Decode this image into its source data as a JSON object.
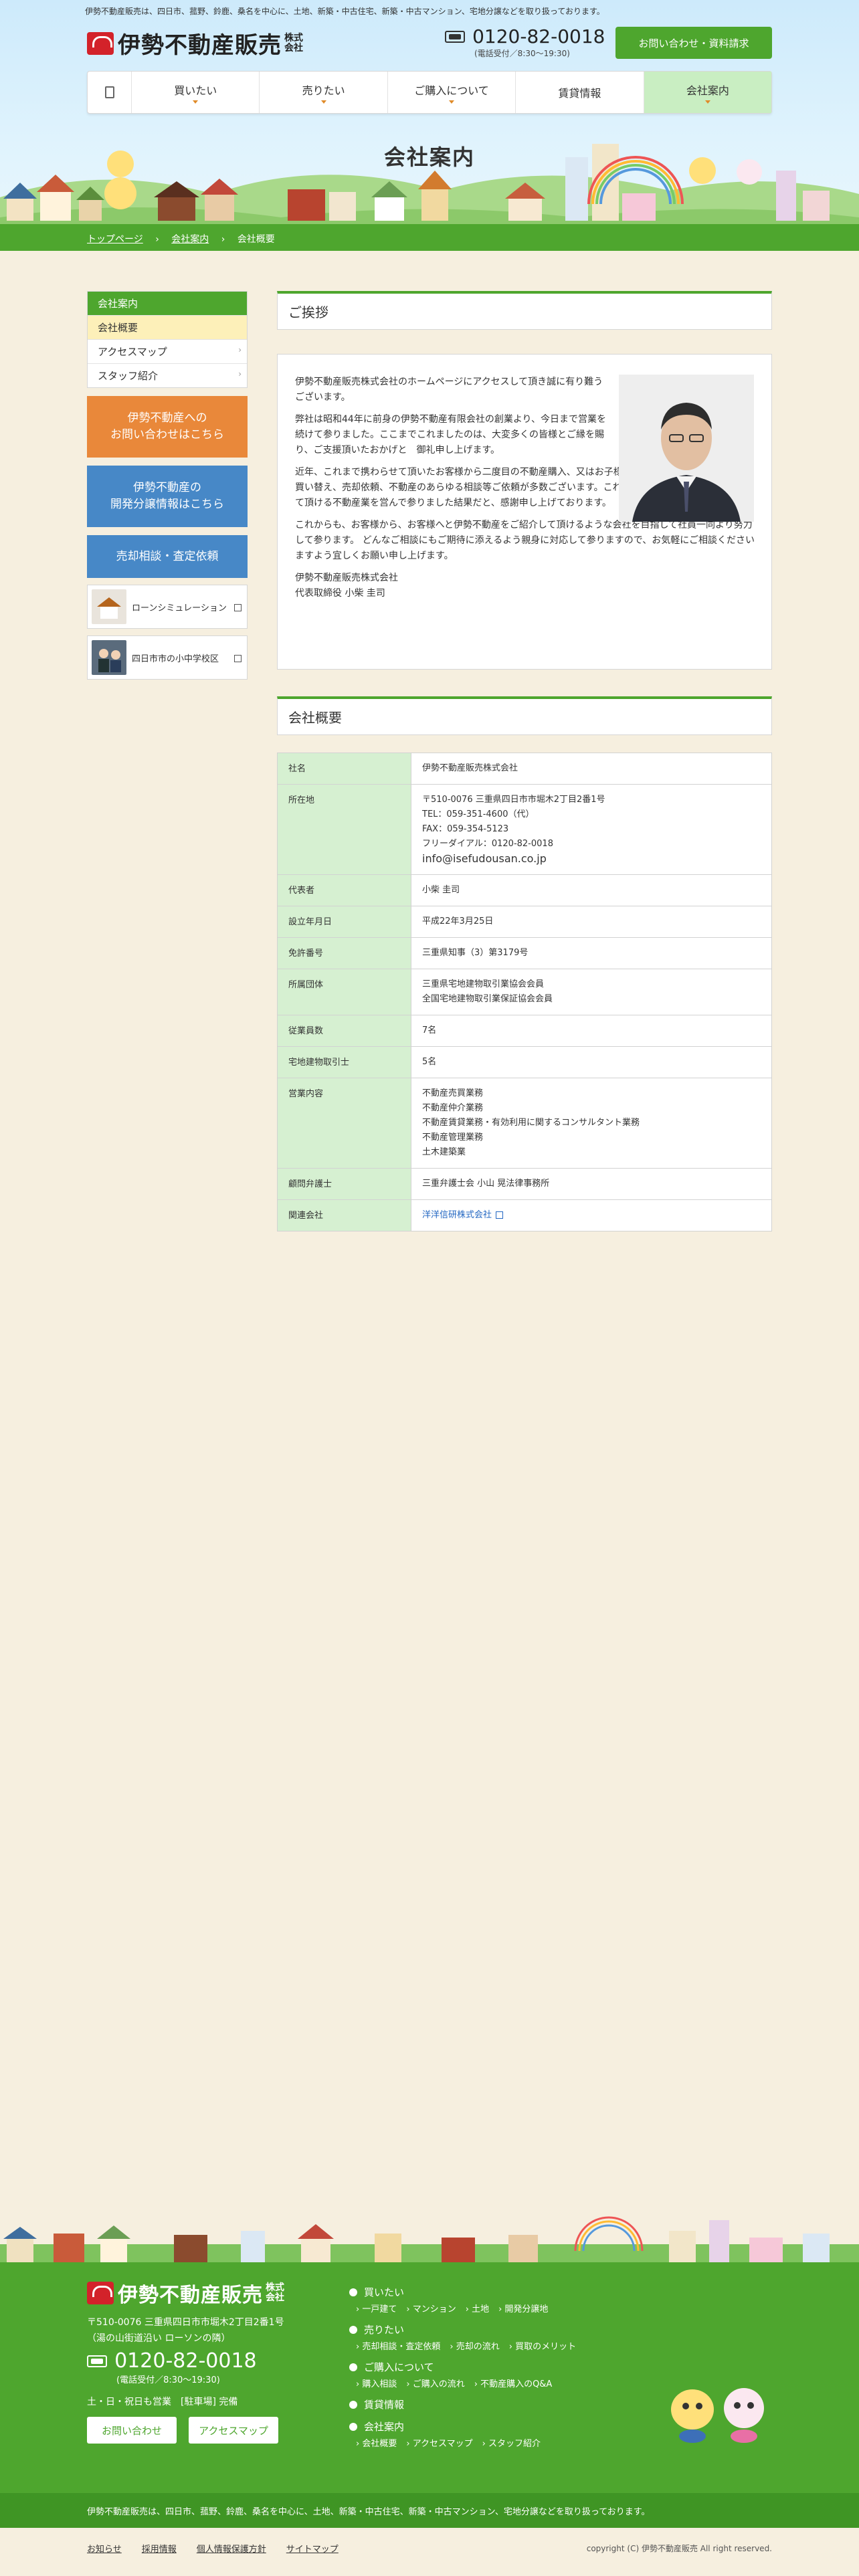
{
  "header": {
    "tagline": "伊勢不動産販売は、四日市、菰野、鈴鹿、桑名を中心に、土地、新築・中古住宅、新築・中古マンション、宅地分譲などを取り扱っております。",
    "logo_text": "伊勢不動産販売",
    "logo_kk": "株式会社",
    "tel": "0120-82-0018",
    "tel_hours": "(電話受付／8:30〜19:30)",
    "contact_button": "お問い合わせ・資料請求"
  },
  "gnav": {
    "items": [
      {
        "label": "買いたい"
      },
      {
        "label": "売りたい"
      },
      {
        "label": "ご購入について"
      },
      {
        "label": "賃貸情報"
      },
      {
        "label": "会社案内"
      }
    ]
  },
  "page_title": "会社案内",
  "breadcrumb": [
    "トップページ",
    "会社案内",
    "会社概要"
  ],
  "sidebar": {
    "head": "会社案内",
    "items": [
      "会社概要",
      "アクセスマップ",
      "スタッフ紹介"
    ],
    "banners": {
      "contact_line1": "伊勢不動産への",
      "contact_line2": "お問い合わせはこちら",
      "sale_line1": "伊勢不動産の",
      "sale_line2": "開発分譲情報はこちら",
      "assess": "売却相談・査定依頼",
      "loan": "ローンシミュレーション",
      "school": "四日市市の小中学校区"
    }
  },
  "greeting": {
    "heading": "ご挨拶",
    "paragraphs": [
      "伊勢不動産販売株式会社のホームページにアクセスして頂き誠に有り難うございます。",
      "弊社は昭和44年に前身の伊勢不動産有限会社の創業より、今日まで営業を続けて参りました。ここまでこれましたのは、大変多くの皆様とご縁を賜り、ご支援頂いたおかげと　御礼申し上げます。",
      "近年、これまで携わらせて頂いたお客様から二度目の不動産購入、又はお子様お身内の方の為の不動産購入、買い替え、売却依頼、不動産のあらゆる相談等ご依頼が多数ございます。これも長年、皆様に信用・信頼をして頂ける不動産業を営んで参りました結果だと、感謝申し上げております。",
      "これからも、お客様から、お客様へと伊勢不動産をご紹介して頂けるような会社を目指して社員一同より努力して参ります。 どんなご相談にもご期待に添えるよう親身に対応して参りますので、お気軽にご相談くださいますよう宜しくお願い申し上げます。"
    ],
    "sign_company": "伊勢不動産販売株式会社",
    "sign_name": "代表取締役 小柴 圭司"
  },
  "profile": {
    "heading": "会社概要",
    "rows": [
      {
        "label": "社名",
        "lines": [
          "伊勢不動産販売株式会社"
        ]
      },
      {
        "label": "所在地",
        "lines": [
          "〒510-0076 三重県四日市市堀木2丁目2番1号",
          "TEL：059-351-4600（代）",
          "FAX：059-354-5123",
          "フリーダイアル：0120-82-0018"
        ],
        "email": "info@isefudousan.co.jp"
      },
      {
        "label": "代表者",
        "lines": [
          "小柴 圭司"
        ]
      },
      {
        "label": "設立年月日",
        "lines": [
          "平成22年3月25日"
        ]
      },
      {
        "label": "免許番号",
        "lines": [
          "三重県知事（3）第3179号"
        ]
      },
      {
        "label": "所属団体",
        "lines": [
          "三重県宅地建物取引業協会会員",
          "全国宅地建物取引業保証協会会員"
        ]
      },
      {
        "label": "従業員数",
        "lines": [
          "7名"
        ]
      },
      {
        "label": "宅地建物取引士",
        "lines": [
          "5名"
        ]
      },
      {
        "label": "営業内容",
        "lines": [
          "不動産売買業務",
          "不動産仲介業務",
          "不動産賃貸業務・有効利用に関するコンサルタント業務",
          "不動産管理業務",
          "土木建築業"
        ]
      },
      {
        "label": "顧問弁護士",
        "lines": [
          "三重弁護士会 小山 晃法律事務所"
        ]
      },
      {
        "label": "関連会社",
        "link": "洋洋信研株式会社"
      }
    ]
  },
  "footer": {
    "logo_text": "伊勢不動産販売",
    "logo_kk": "株式会社",
    "address1": "〒510-0076 三重県四日市市堀木2丁目2番1号",
    "address2": "（湯の山街道沿い ローソンの隣）",
    "tel": "0120-82-0018",
    "tel_hours": "(電話受付／8:30〜19:30)",
    "holiday": "土・日・祝日も営業　[駐車場] 完備",
    "btn_contact": "お問い合わせ",
    "btn_access": "アクセスマップ",
    "nav": [
      {
        "head": "買いたい",
        "subs": [
          "一戸建て",
          "マンション",
          "土地",
          "開発分譲地"
        ]
      },
      {
        "head": "売りたい",
        "subs": [
          "売却相談・査定依頼",
          "売却の流れ",
          "買取のメリット"
        ]
      },
      {
        "head": "ご購入について",
        "subs": [
          "購入相談",
          "ご購入の流れ",
          "不動産購入のQ&A"
        ]
      },
      {
        "head": "賃貸情報",
        "subs": []
      },
      {
        "head": "会社案内",
        "subs": [
          "会社概要",
          "アクセスマップ",
          "スタッフ紹介"
        ]
      }
    ],
    "bottom_text": "伊勢不動産販売は、四日市、菰野、鈴鹿、桑名を中心に、土地、新築・中古住宅、新築・中古マンション、宅地分譲などを取り扱っております。",
    "links": [
      "お知らせ",
      "採用情報",
      "個人情報保護方針",
      "サイトマップ"
    ],
    "copyright": "copyright (C) 伊勢不動産販売 All right reserved."
  },
  "colors": {
    "brand_green": "#4ea62e",
    "accent_orange": "#e9883a",
    "accent_blue": "#4788c7",
    "logo_red": "#d3222a",
    "background": "#f6efdf"
  }
}
